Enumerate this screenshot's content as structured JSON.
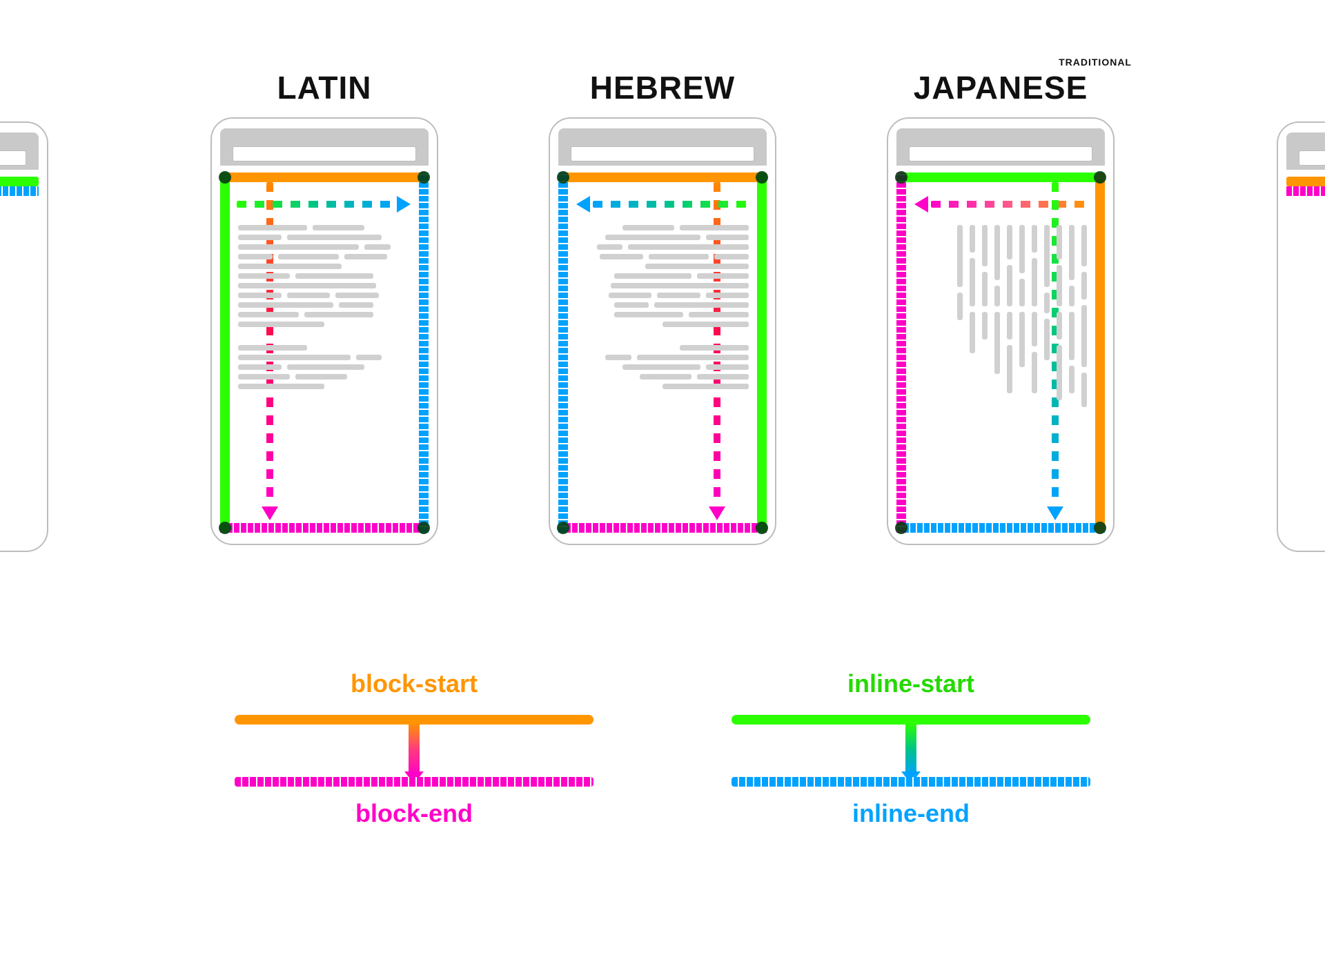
{
  "titles": {
    "latin": "LATIN",
    "hebrew": "HEBREW",
    "japanese": "JAPANESE",
    "japanese_sup": "TRADITIONAL"
  },
  "legend": {
    "block_start": "block-start",
    "block_end": "block-end",
    "inline_start": "inline-start",
    "inline_end": "inline-end"
  },
  "colors": {
    "orange": "#ff9500",
    "magenta": "#ff00c8",
    "green": "#2bff00",
    "blue": "#00a2ff"
  },
  "devices": [
    {
      "id": "latin",
      "writing_mode": "horizontal-tb",
      "direction": "ltr",
      "block_start_edge": "top",
      "block_end_edge": "bottom",
      "inline_start_edge": "left",
      "inline_end_edge": "right",
      "block_flow_arrow": "top-to-bottom",
      "inline_flow_arrow": "left-to-right"
    },
    {
      "id": "hebrew",
      "writing_mode": "horizontal-tb",
      "direction": "rtl",
      "block_start_edge": "top",
      "block_end_edge": "bottom",
      "inline_start_edge": "right",
      "inline_end_edge": "left",
      "block_flow_arrow": "top-to-bottom",
      "inline_flow_arrow": "right-to-left"
    },
    {
      "id": "japanese",
      "writing_mode": "vertical-rl",
      "direction": "ltr",
      "block_start_edge": "right",
      "block_end_edge": "left",
      "inline_start_edge": "top",
      "inline_end_edge": "bottom",
      "block_flow_arrow": "right-to-left",
      "inline_flow_arrow": "top-to-bottom"
    }
  ]
}
